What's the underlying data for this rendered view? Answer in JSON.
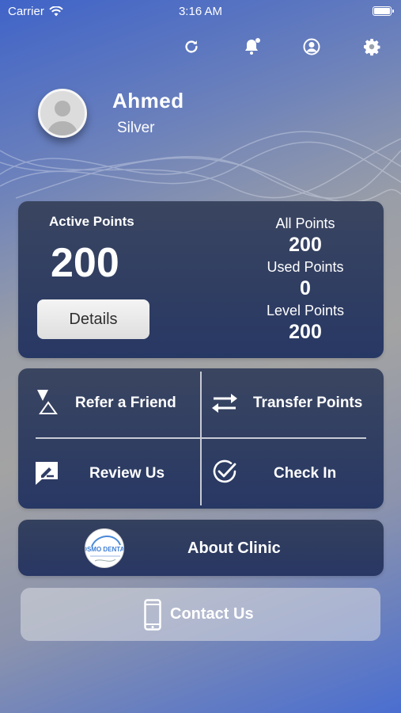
{
  "status_bar": {
    "carrier": "Carrier",
    "time": "3:16 AM"
  },
  "top_icons": [
    "refresh-icon",
    "bell-icon",
    "profile-icon",
    "gear-icon"
  ],
  "profile": {
    "name": "Ahmed",
    "level": "Silver"
  },
  "points": {
    "active_label": "Active Points",
    "active_value": "200",
    "details_label": "Details",
    "stats": [
      {
        "label": "All Points",
        "value": "200"
      },
      {
        "label": "Used Points",
        "value": "0"
      },
      {
        "label": "Level Points",
        "value": "200"
      }
    ]
  },
  "actions": {
    "refer": "Refer a Friend",
    "transfer": "Transfer Points",
    "review": "Review Us",
    "checkin": "Check In"
  },
  "about": {
    "label": "About Clinic",
    "logo_text": "OSMO DENTAL"
  },
  "contact": {
    "label": "Contact Us"
  },
  "colors": {
    "card": "#2f3c63",
    "accent_blue": "#4a6ed0"
  }
}
